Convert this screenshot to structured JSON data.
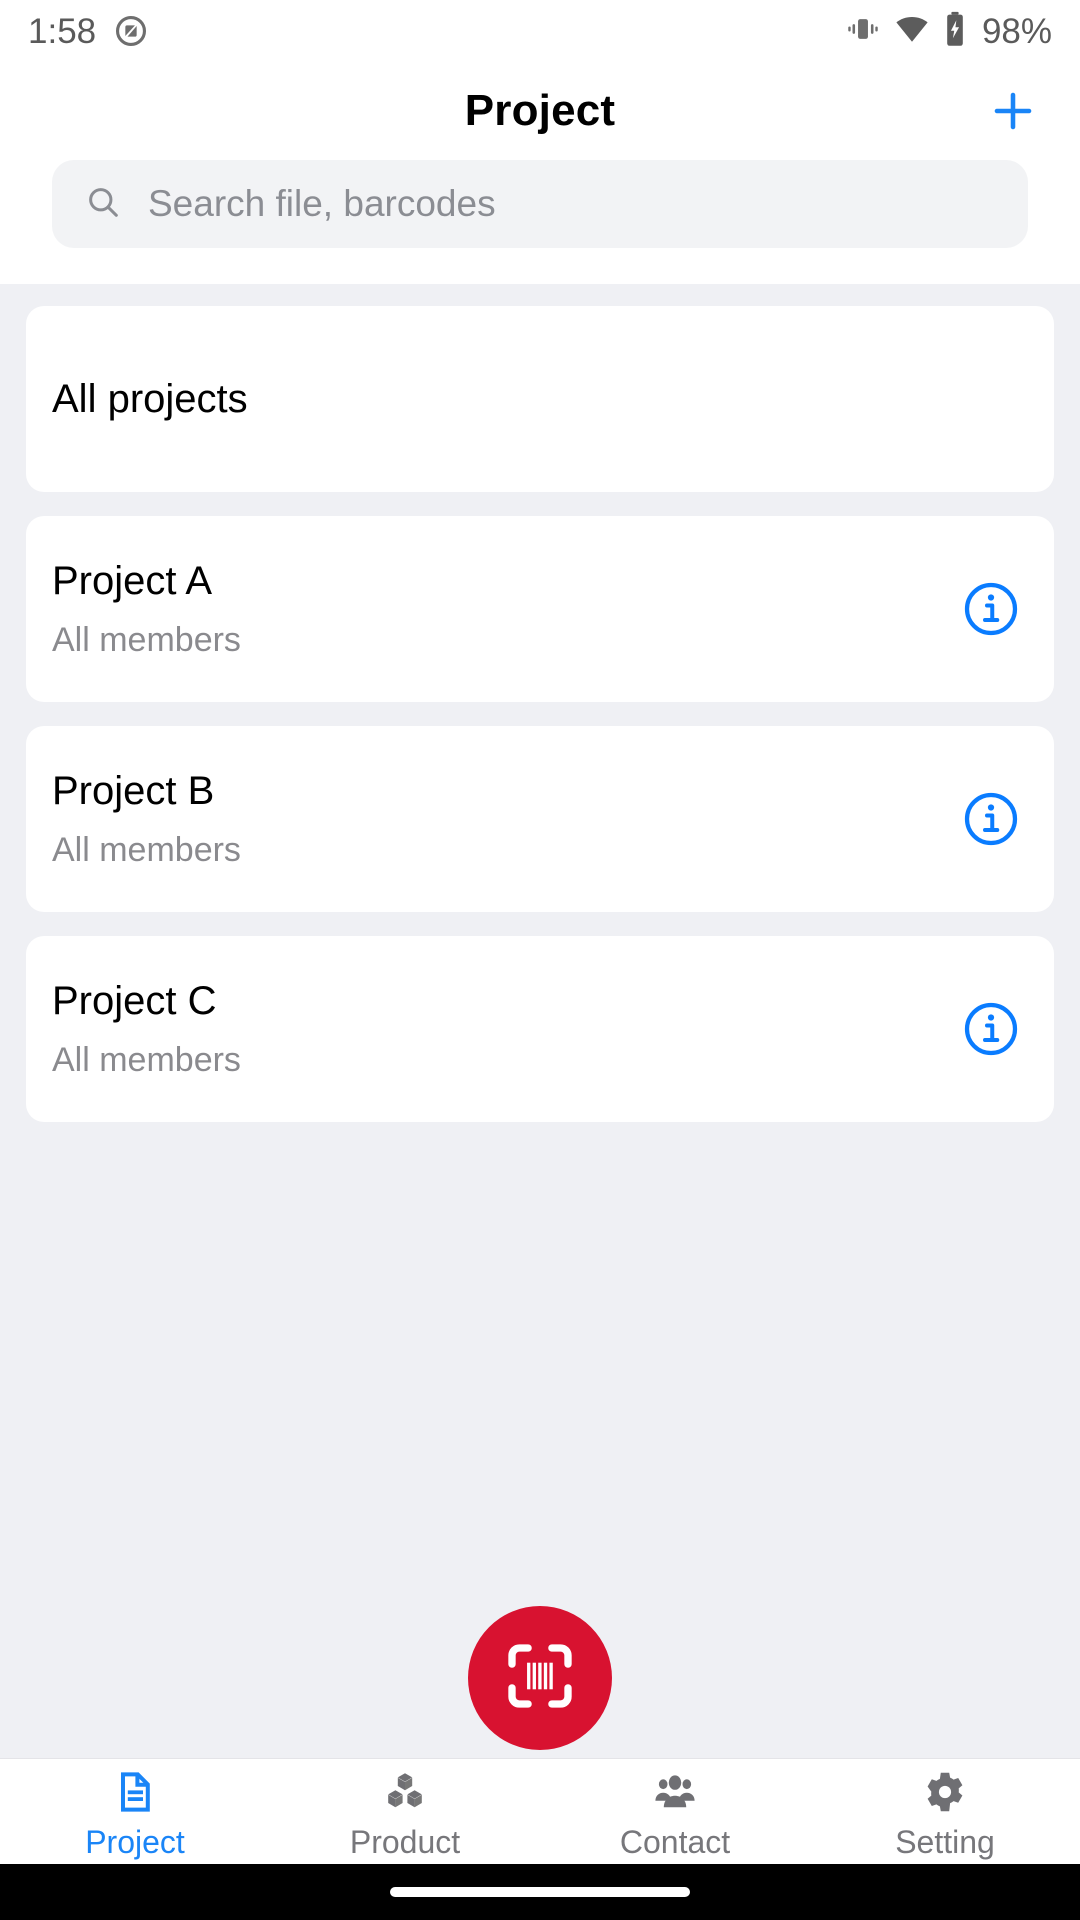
{
  "status_bar": {
    "time": "1:58",
    "app_icon": "do-not-disturb-icon",
    "vibrate_icon": "vibrate-icon",
    "wifi_icon": "wifi-icon",
    "battery_icon": "battery-charging-icon",
    "battery_text": "98%"
  },
  "header": {
    "title": "Project",
    "add_icon": "plus-icon",
    "accent_color": "#1a85f7"
  },
  "search": {
    "icon": "search-icon",
    "placeholder": "Search file, barcodes",
    "value": ""
  },
  "list": {
    "all_projects": {
      "title": "All projects"
    },
    "projects": [
      {
        "title": "Project A",
        "subtitle": "All members",
        "info_icon": "info-circle-icon"
      },
      {
        "title": "Project B",
        "subtitle": "All members",
        "info_icon": "info-circle-icon"
      },
      {
        "title": "Project C",
        "subtitle": "All members",
        "info_icon": "info-circle-icon"
      }
    ]
  },
  "scan_button": {
    "icon": "barcode-scan-icon",
    "color": "#d81230",
    "label": ""
  },
  "bottom_nav": {
    "active_index": 0,
    "active_color": "#1a85f7",
    "inactive_color": "#77777b",
    "items": [
      {
        "label": "Project",
        "icon": "document-icon"
      },
      {
        "label": "Product",
        "icon": "boxes-icon"
      },
      {
        "label": "Contact",
        "icon": "people-icon"
      },
      {
        "label": "Setting",
        "icon": "gear-icon"
      }
    ]
  }
}
